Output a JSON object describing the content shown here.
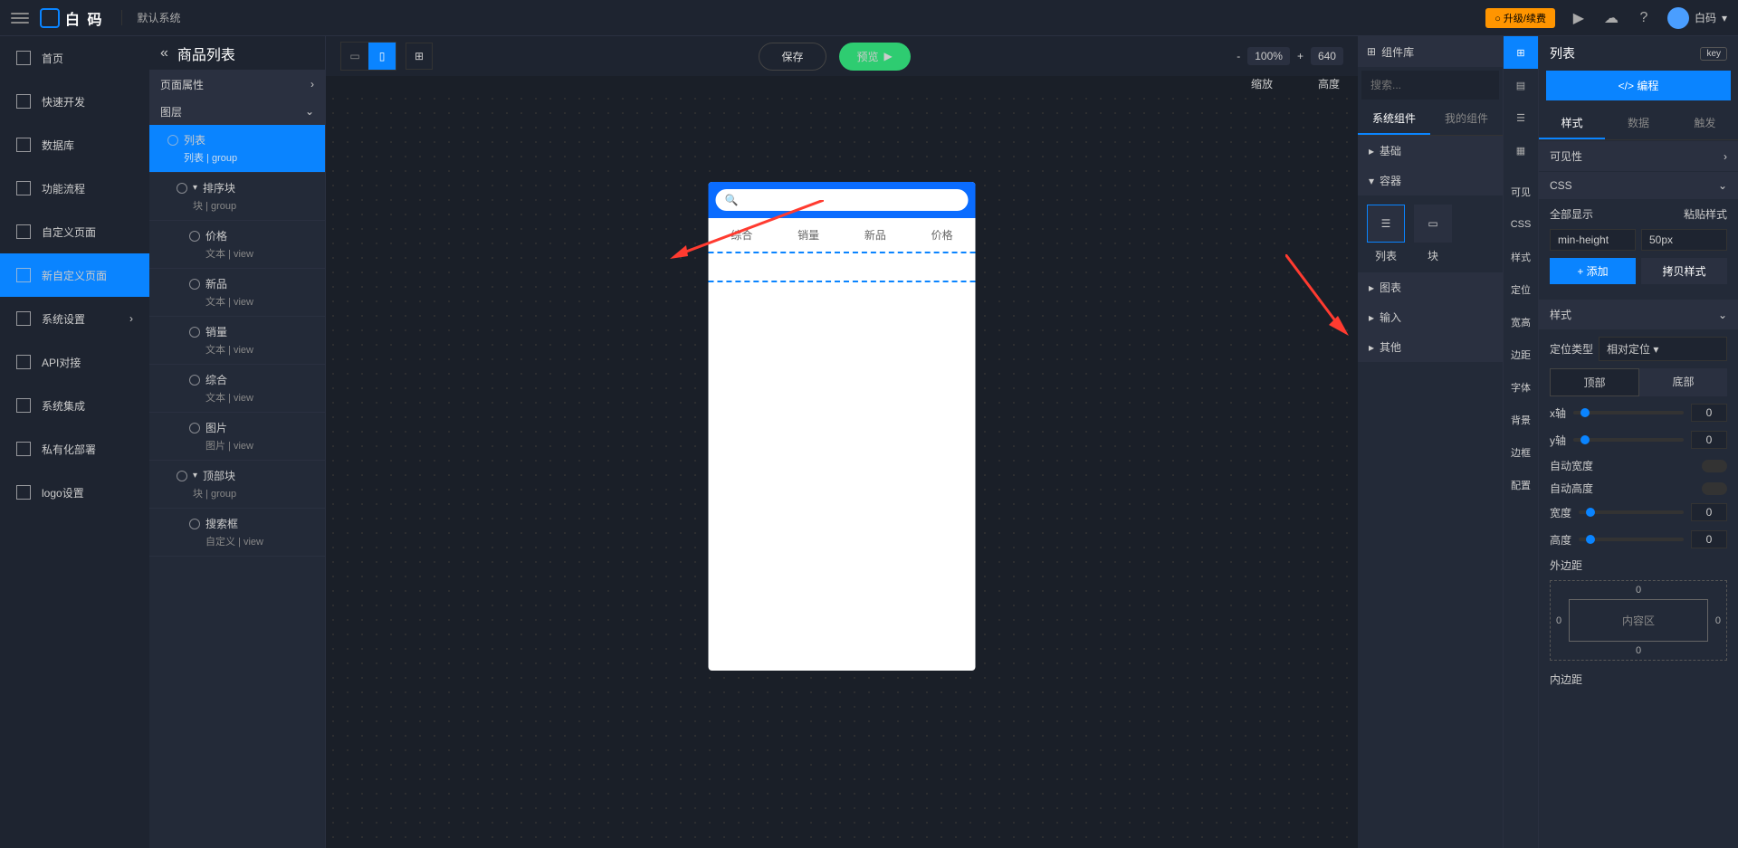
{
  "topbar": {
    "brand": "白 码",
    "system": "默认系统",
    "upgrade": "○ 升级/续费",
    "user": "白码"
  },
  "leftnav": [
    {
      "label": "首页"
    },
    {
      "label": "快速开发"
    },
    {
      "label": "数据库"
    },
    {
      "label": "功能流程"
    },
    {
      "label": "自定义页面"
    },
    {
      "label": "新自定义页面",
      "active": true
    },
    {
      "label": "系统设置",
      "expand": true
    },
    {
      "label": "API对接"
    },
    {
      "label": "系统集成"
    },
    {
      "label": "私有化部署"
    },
    {
      "label": "logo设置"
    }
  ],
  "page": {
    "title": "商品列表",
    "sections": {
      "props": "页面属性",
      "layers": "图层"
    }
  },
  "layers": [
    {
      "name": "列表",
      "meta": "列表 | group",
      "active": true,
      "depth": 0
    },
    {
      "name": "排序块",
      "meta": "块 | group",
      "depth": 1,
      "caret": true
    },
    {
      "name": "价格",
      "meta": "文本 | view",
      "depth": 2
    },
    {
      "name": "新品",
      "meta": "文本 | view",
      "depth": 2
    },
    {
      "name": "销量",
      "meta": "文本 | view",
      "depth": 2
    },
    {
      "name": "综合",
      "meta": "文本 | view",
      "depth": 2
    },
    {
      "name": "图片",
      "meta": "图片 | view",
      "depth": 2
    },
    {
      "name": "顶部块",
      "meta": "块 | group",
      "depth": 1,
      "caret": true
    },
    {
      "name": "搜索框",
      "meta": "自定义 | view",
      "depth": 2
    }
  ],
  "toolbar": {
    "save": "保存",
    "preview": "预览",
    "zoom": {
      "minus": "-",
      "val": "100%",
      "plus": "+",
      "label": "缩放"
    },
    "width": {
      "val": "640",
      "label": "高度"
    }
  },
  "phone": {
    "tabs": [
      "综合",
      "销量",
      "新品",
      "价格"
    ]
  },
  "compPanel": {
    "title": "组件库",
    "searchPlaceholder": "搜索...",
    "tabs": [
      "系统组件",
      "我的组件"
    ],
    "cats": {
      "basic": "基础",
      "container": "容器",
      "chart": "图表",
      "input": "输入",
      "other": "其他"
    },
    "items": [
      {
        "label": "列表",
        "active": true
      },
      {
        "label": "块"
      }
    ]
  },
  "vstrip": [
    "可见",
    "CSS",
    "样式",
    "定位",
    "宽高",
    "边距",
    "字体",
    "背景",
    "边框",
    "配置"
  ],
  "rpanel": {
    "title": "列表",
    "key": "key",
    "code": "</> 编程",
    "tabs": [
      "样式",
      "数据",
      "触发"
    ],
    "visibility": "可见性",
    "css": {
      "title": "CSS",
      "showAll": "全部显示",
      "paste": "粘贴样式",
      "k": "min-height",
      "v": "50px",
      "add": "+ 添加",
      "copy": "拷贝样式"
    },
    "style": {
      "title": "样式",
      "posType": "定位类型",
      "posVal": "相对定位",
      "top": "顶部",
      "bottom": "底部",
      "x": "x轴",
      "y": "y轴",
      "autoW": "自动宽度",
      "autoH": "自动高度",
      "w": "宽度",
      "h": "高度"
    },
    "margin": {
      "title": "外边距",
      "content": "内容区",
      "t": "0",
      "b": "0",
      "l": "0",
      "r": "0"
    },
    "padding": "内边距"
  }
}
